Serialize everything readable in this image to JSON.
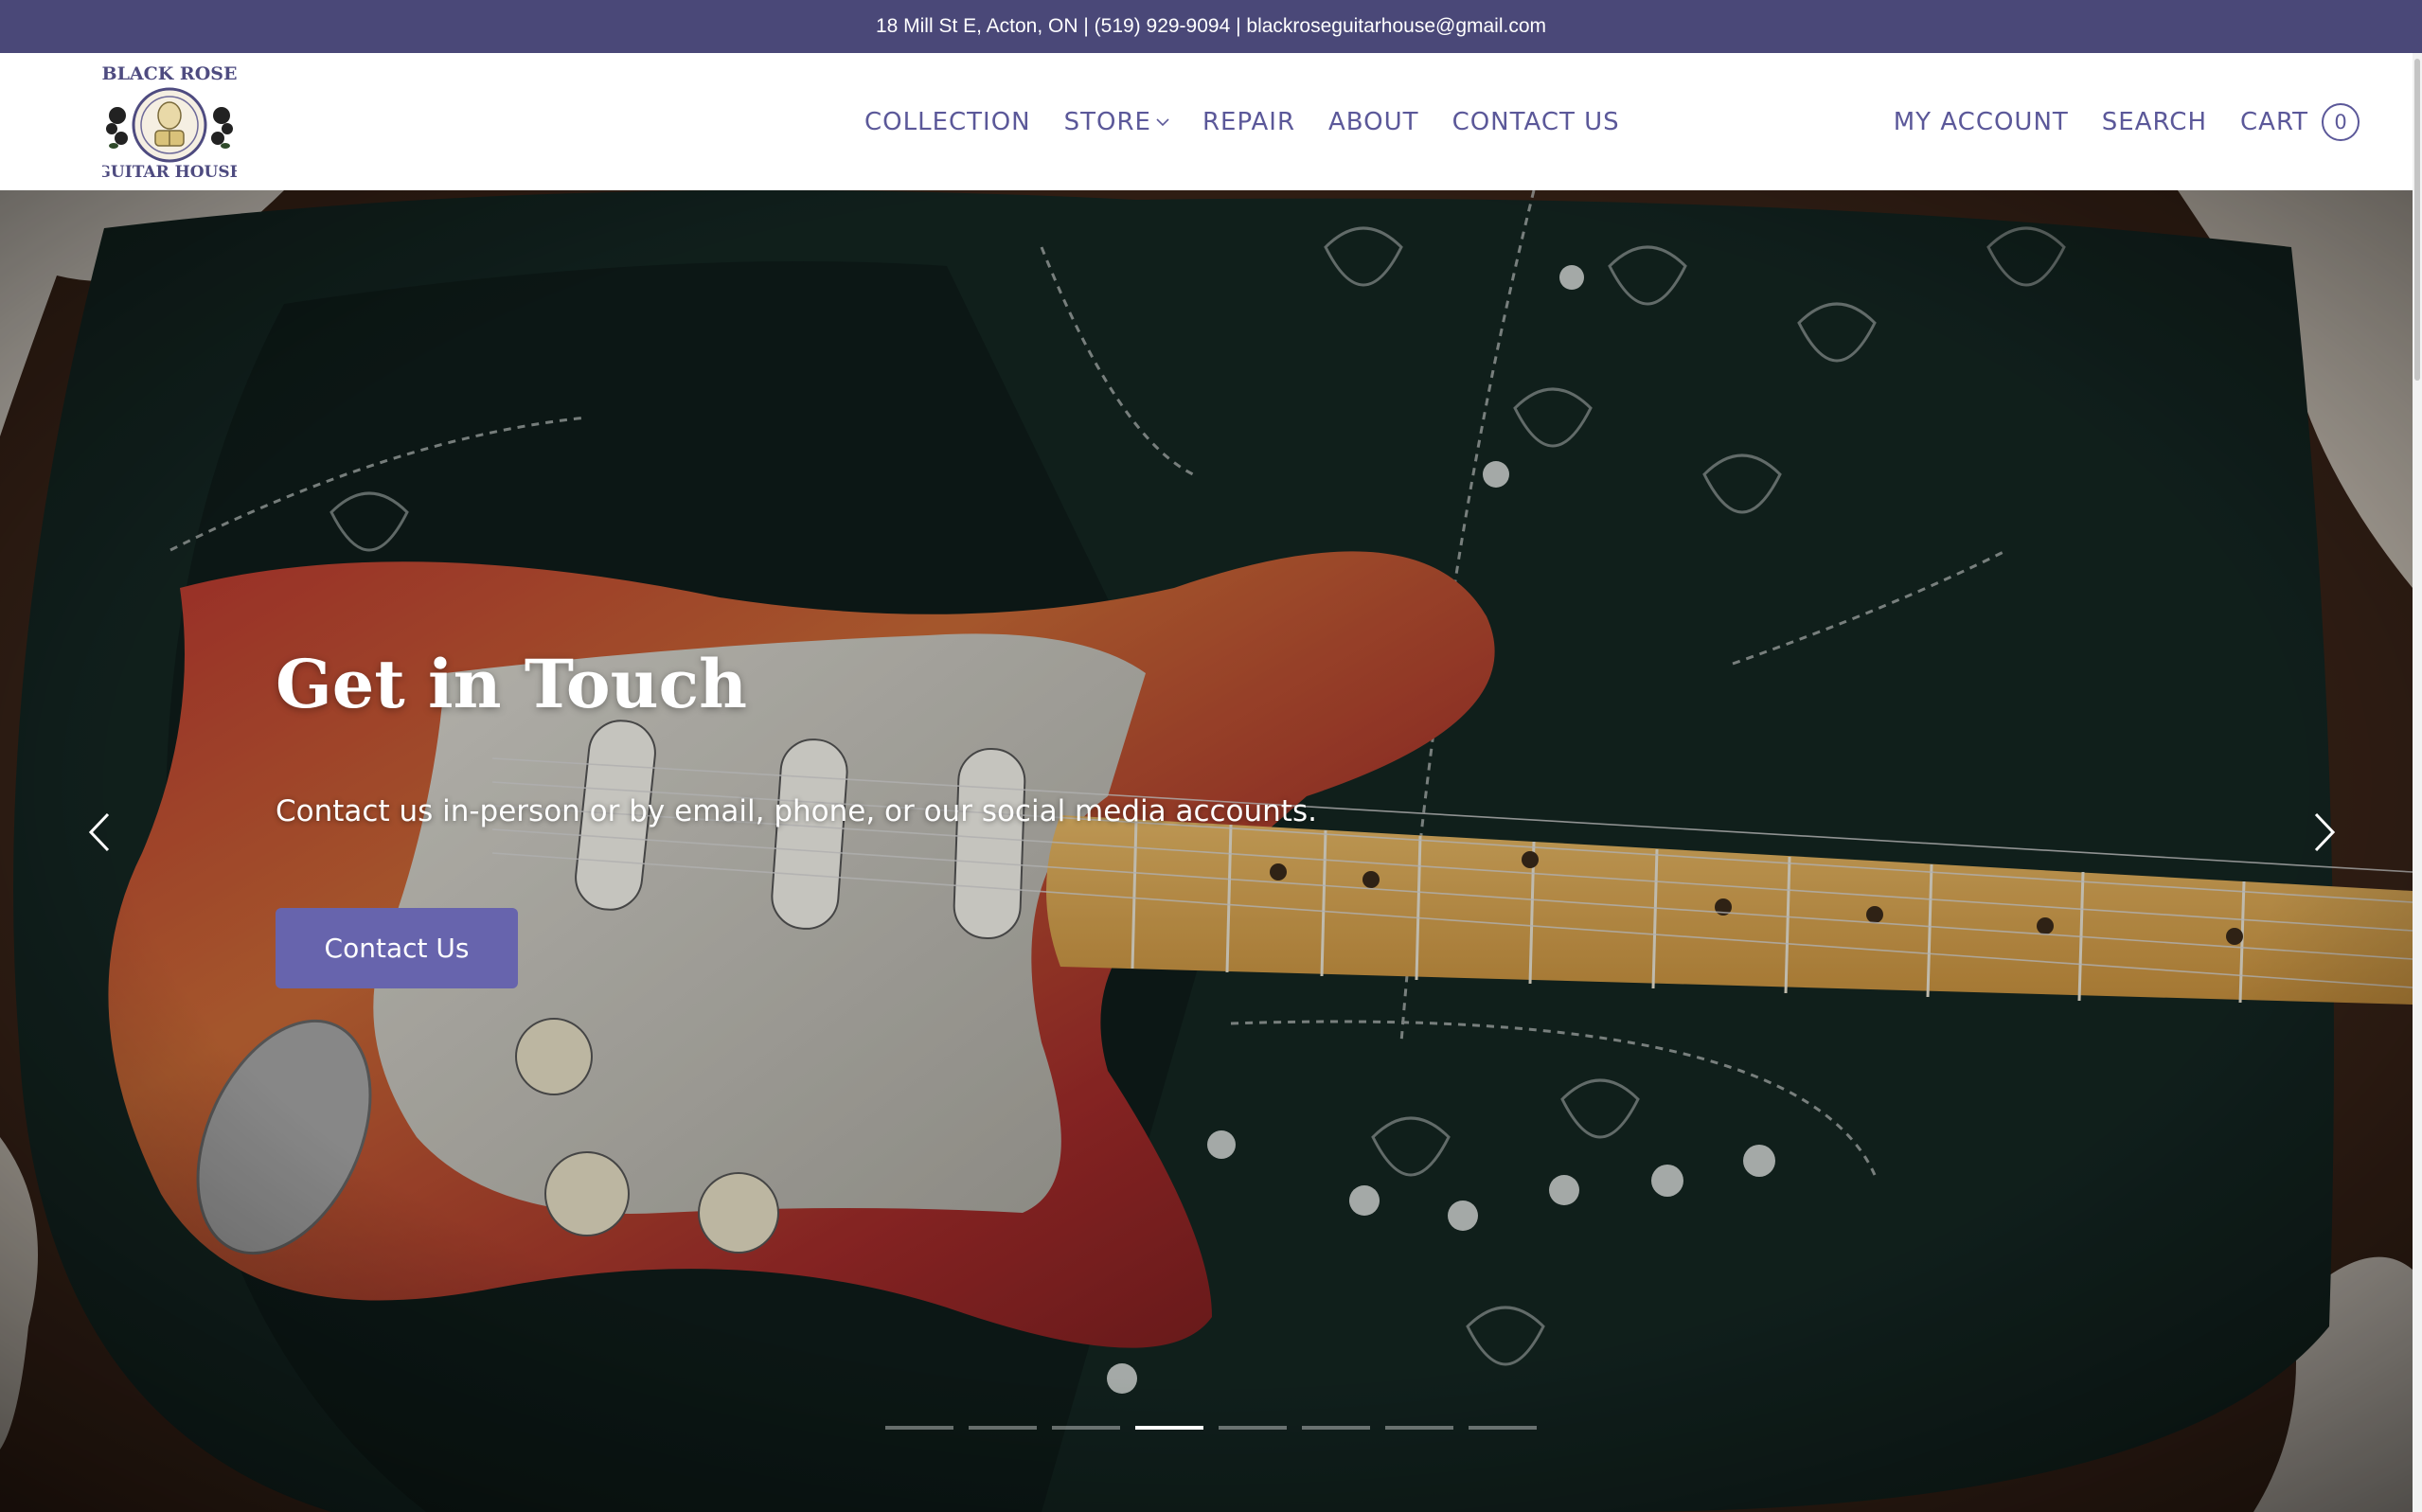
{
  "announcement": {
    "text": "18 Mill St E, Acton, ON | (519) 929-9094 | blackroseguitarhouse@gmail.com"
  },
  "logo": {
    "line1": "BLACK ROSE",
    "line2": "GUITAR HOUSE",
    "icon": "black-rose-guitar-house-logo"
  },
  "nav": {
    "main": [
      {
        "label": "COLLECTION"
      },
      {
        "label": "STORE",
        "icon": "chevron-down-icon"
      },
      {
        "label": "REPAIR"
      },
      {
        "label": "ABOUT"
      },
      {
        "label": "CONTACT US"
      }
    ],
    "right": {
      "account": "MY ACCOUNT",
      "search": "SEARCH",
      "cart": "CART",
      "cart_count": "0"
    }
  },
  "hero": {
    "title": "Get in Touch",
    "subtitle": "Contact us in-person or by email, phone, or our social media accounts.",
    "button_label": "Contact Us",
    "prev_icon": "chevron-left-icon",
    "next_icon": "chevron-right-icon",
    "slide_count": 8,
    "active_slide": 4
  },
  "colors": {
    "brand": "#4a4878",
    "nav_text": "#5b5899",
    "button": "#6764ad"
  }
}
